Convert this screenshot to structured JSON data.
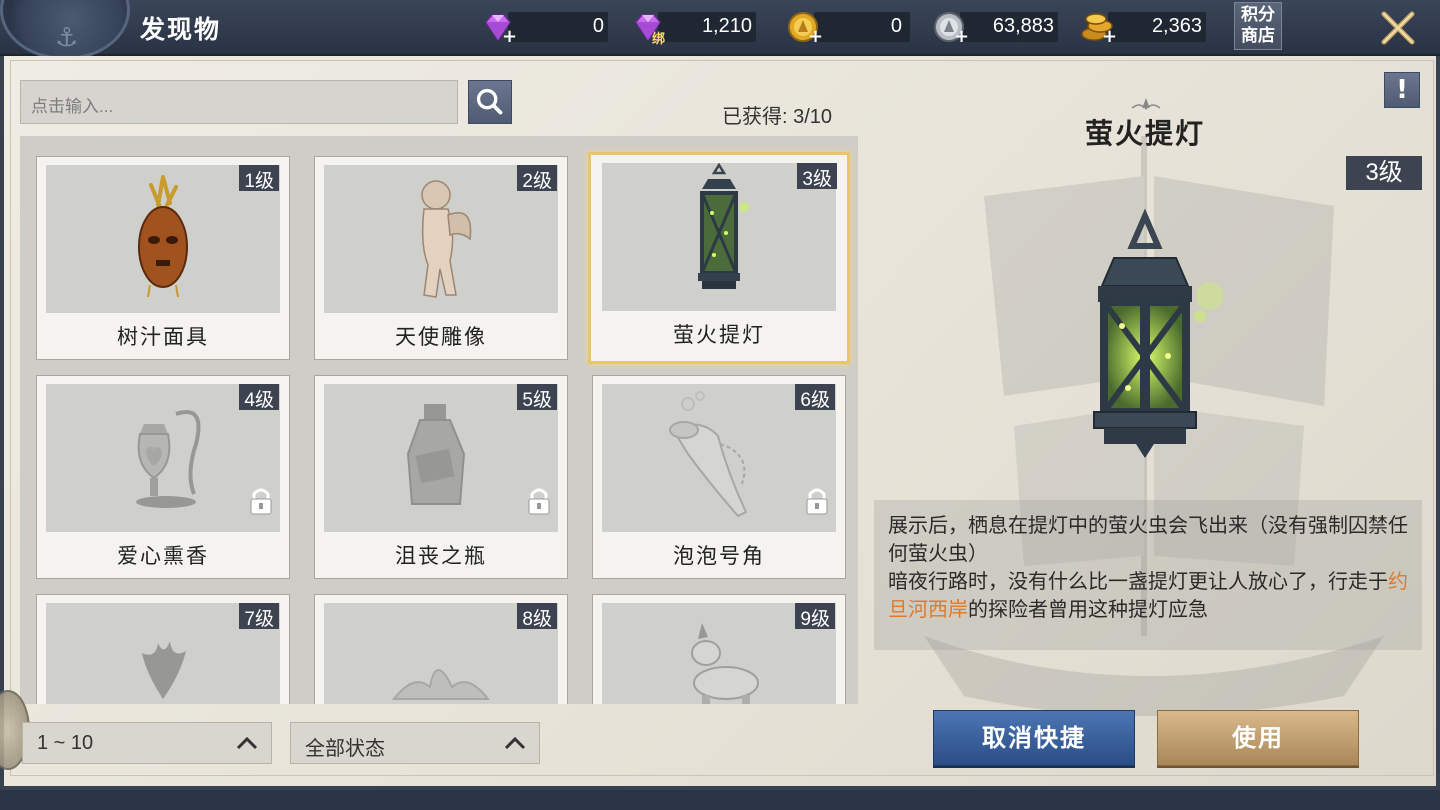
{
  "header": {
    "title": "发现物",
    "shop_label_line1": "积分",
    "shop_label_line2": "商店"
  },
  "currencies": [
    {
      "icon": "diamond-icon",
      "value": "0"
    },
    {
      "icon": "bound-diamond-icon",
      "value": "1,210",
      "tag": "绑"
    },
    {
      "icon": "gold-coin-icon",
      "value": "0"
    },
    {
      "icon": "silver-coin-icon",
      "value": "63,883"
    },
    {
      "icon": "gold-coins-stack-icon",
      "value": "2,363"
    }
  ],
  "search": {
    "placeholder": "点击输入..."
  },
  "obtained": "已获得: 3/10",
  "items": [
    {
      "name": "树汁面具",
      "level": "1级",
      "locked": false,
      "selected": false,
      "icon": "sap-mask-icon"
    },
    {
      "name": "天使雕像",
      "level": "2级",
      "locked": false,
      "selected": false,
      "icon": "angel-statue-icon"
    },
    {
      "name": "萤火提灯",
      "level": "3级",
      "locked": false,
      "selected": true,
      "icon": "firefly-lantern-icon"
    },
    {
      "name": "爱心熏香",
      "level": "4级",
      "locked": true,
      "selected": false,
      "icon": "heart-incense-icon"
    },
    {
      "name": "沮丧之瓶",
      "level": "5级",
      "locked": true,
      "selected": false,
      "icon": "dismay-bottle-icon"
    },
    {
      "name": "泡泡号角",
      "level": "6级",
      "locked": true,
      "selected": false,
      "icon": "bubble-horn-icon"
    },
    {
      "name": "",
      "level": "7级",
      "locked": true,
      "selected": false,
      "icon": "plant-icon"
    },
    {
      "name": "",
      "level": "8级",
      "locked": true,
      "selected": false,
      "icon": "lotus-icon"
    },
    {
      "name": "",
      "level": "9级",
      "locked": true,
      "selected": false,
      "icon": "toy-horse-icon"
    }
  ],
  "filters": {
    "range": "1 ~ 10",
    "status": "全部状态"
  },
  "detail": {
    "name": "萤火提灯",
    "level": "3级",
    "info_icon": "!",
    "desc_line1": "展示后，栖息在提灯中的萤火虫会飞出来（没有强制囚禁任何萤火虫）",
    "desc_line2_pre": "暗夜行路时，没有什么比一盏提灯更让人放心了，行走于",
    "desc_line2_highlight": "约旦河西岸",
    "desc_line2_post": "的探险者曾用这种提灯应急",
    "highlight_color": "#e07a2a"
  },
  "buttons": {
    "cancel": "取消快捷",
    "use": "使用"
  }
}
